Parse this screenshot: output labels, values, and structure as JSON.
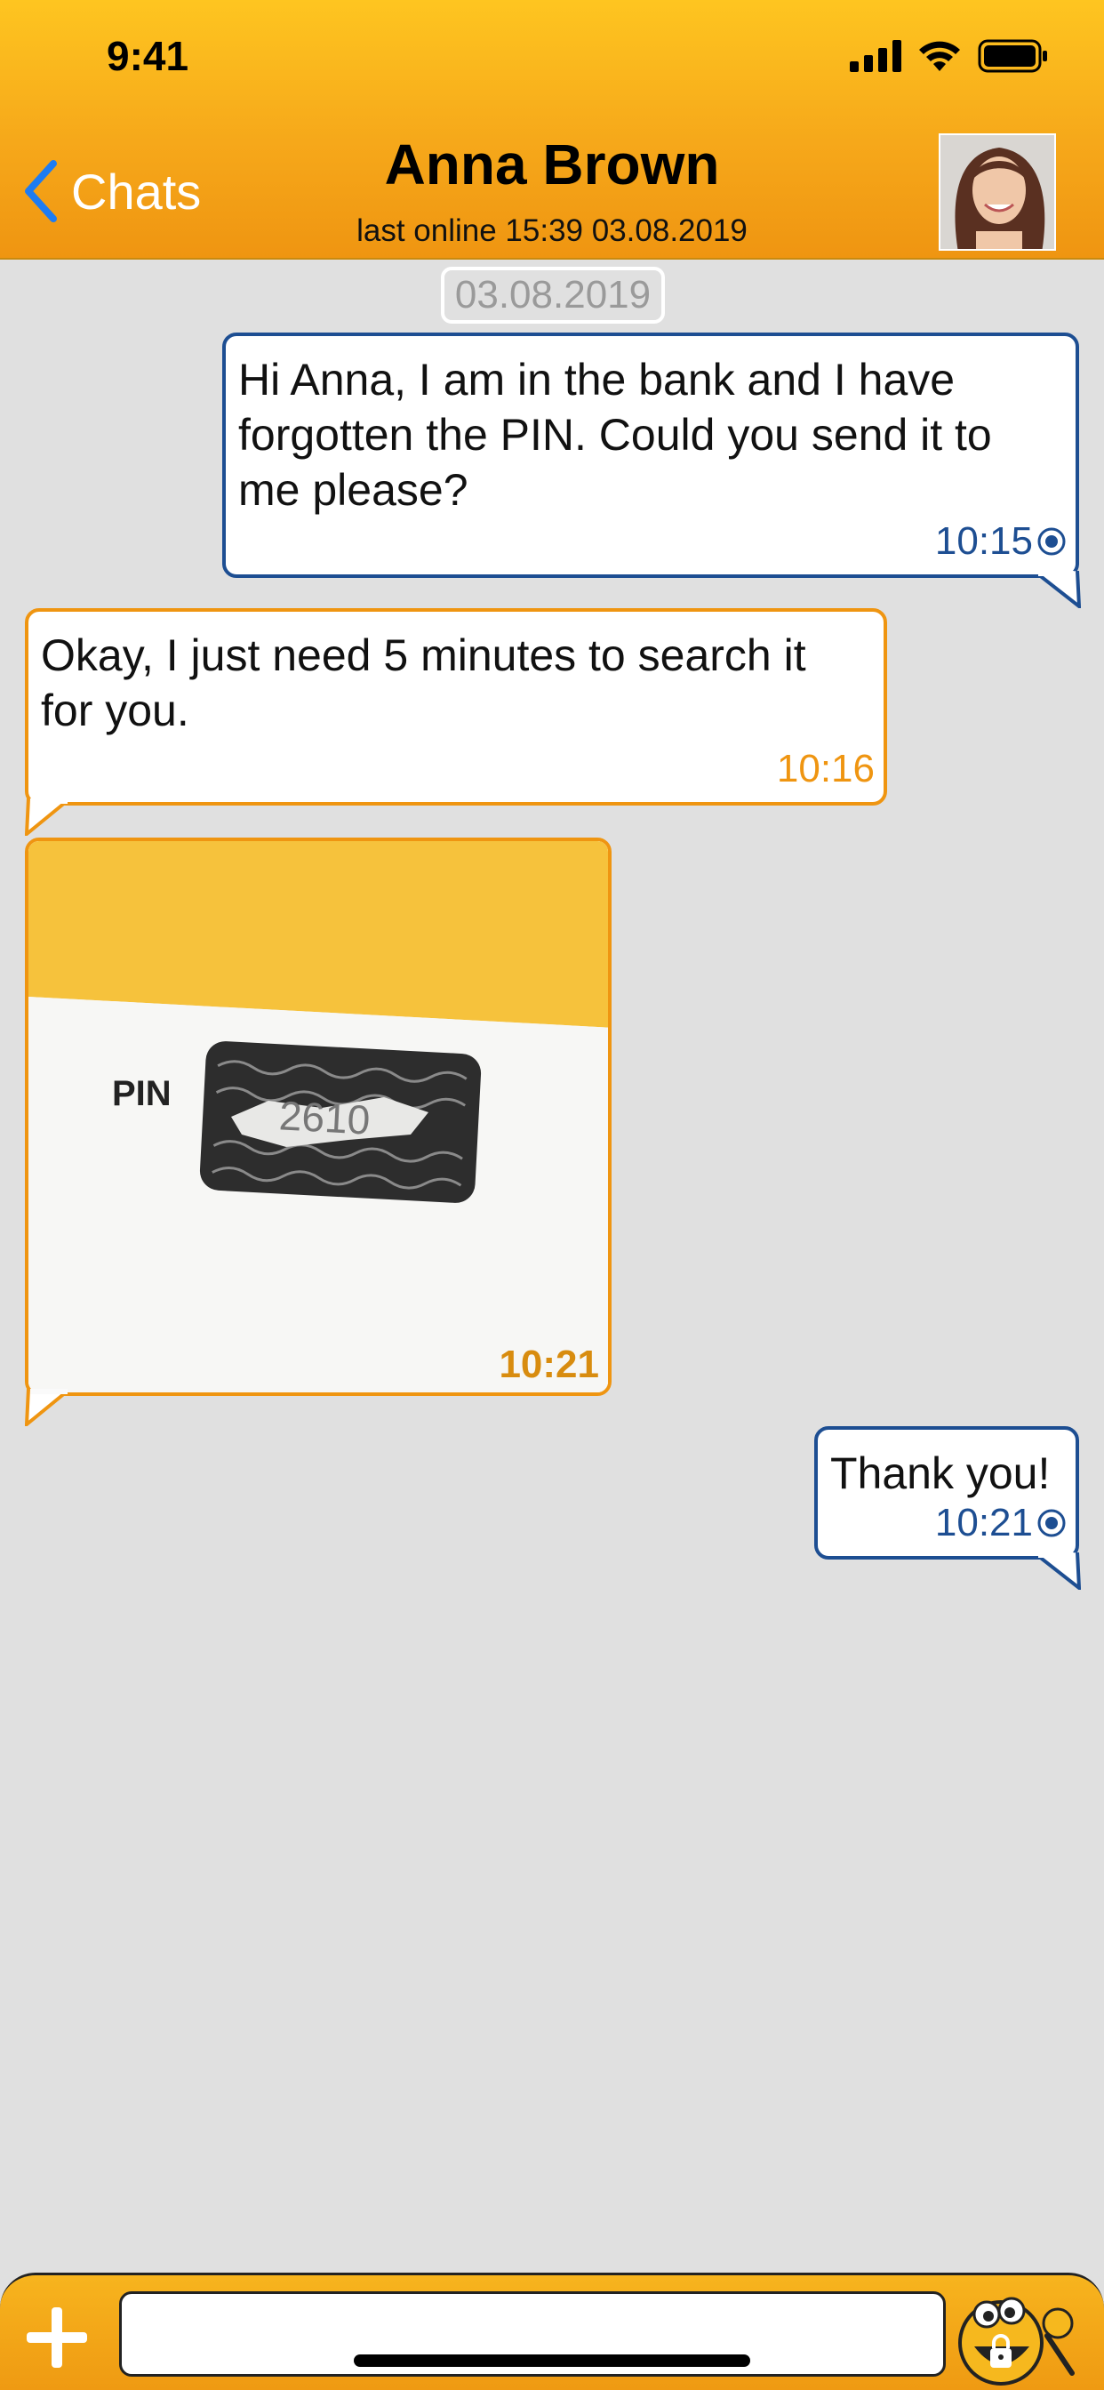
{
  "status_bar": {
    "time": "9:41"
  },
  "header": {
    "back_label": "Chats",
    "title": "Anna Brown",
    "subtitle": "last online 15:39 03.08.2019"
  },
  "date_separator": "03.08.2019",
  "messages": [
    {
      "direction": "out",
      "text": "Hi Anna, I am in the bank and I have forgotten the PIN. Could you send it to me please?",
      "time": "10:15"
    },
    {
      "direction": "in",
      "text": "Okay, I just need 5 minutes to search it for you.",
      "time": "10:16"
    },
    {
      "direction": "in",
      "type": "image",
      "image_label": "PIN",
      "image_code": "2610",
      "time": "10:21"
    },
    {
      "direction": "out",
      "text": "Thank you!",
      "time": "10:21"
    }
  ],
  "input": {
    "placeholder": ""
  },
  "colors": {
    "header_top": "#fec520",
    "header_bottom": "#ef9511",
    "outgoing_border": "#1d4e92",
    "incoming_border": "#ef9511",
    "background": "#e0e0e0"
  }
}
